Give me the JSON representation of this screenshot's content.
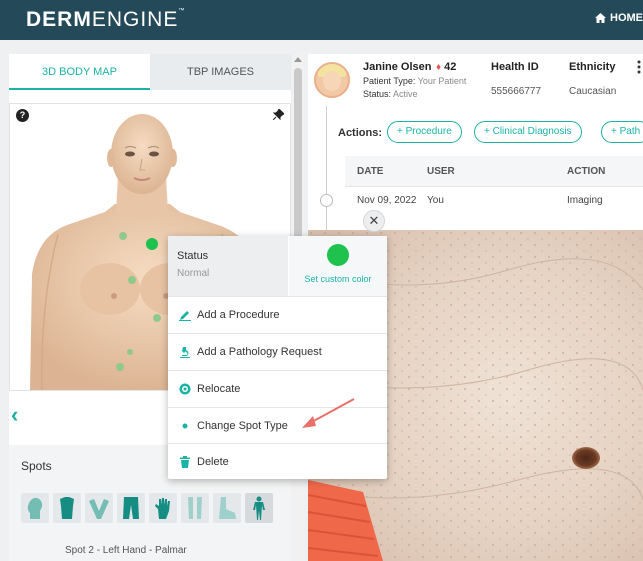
{
  "brand": {
    "name_bold": "DERM",
    "name_light": "ENGINE",
    "tm": "™"
  },
  "nav": {
    "home": "HOME"
  },
  "left": {
    "tabs": [
      {
        "label": "3D BODY MAP",
        "active": true
      },
      {
        "label": "TBP IMAGES",
        "active": false
      }
    ],
    "spots_title": "Spots",
    "spot_caption": "Spot 2 - Left Hand - Palmar"
  },
  "patient": {
    "name": "Janine Olsen",
    "spot_count": "42",
    "type_label": "Patient Type:",
    "type_value": "Your Patient",
    "status_label": "Status:",
    "status_value": "Active",
    "health_id_label": "Health ID",
    "health_id": "555666777",
    "ethnicity_label": "Ethnicity",
    "ethnicity": "Caucasian"
  },
  "actions": {
    "label": "Actions:",
    "buttons": [
      "+ Procedure",
      "+ Clinical Diagnosis",
      "+ Path"
    ]
  },
  "history": {
    "columns": [
      "DATE",
      "USER",
      "ACTION"
    ],
    "rows": [
      [
        "Nov 09, 2022",
        "You",
        "Imaging"
      ]
    ]
  },
  "popup": {
    "status_title": "Status",
    "status_value": "Normal",
    "custom_color_label": "Set custom color",
    "custom_color": "#1ec24c",
    "items": [
      {
        "label": "Add a Procedure",
        "icon": "pen-icon"
      },
      {
        "label": "Add a Pathology Request",
        "icon": "microscope-icon"
      },
      {
        "label": "Relocate",
        "icon": "target-icon"
      },
      {
        "label": "Change Spot Type",
        "icon": "dot-icon"
      },
      {
        "label": "Delete",
        "icon": "trash-icon"
      }
    ]
  },
  "colors": {
    "accent": "#1ab3a6",
    "header": "#244a5a",
    "spot": "#1ec24c",
    "arrow": "#e9706a"
  }
}
